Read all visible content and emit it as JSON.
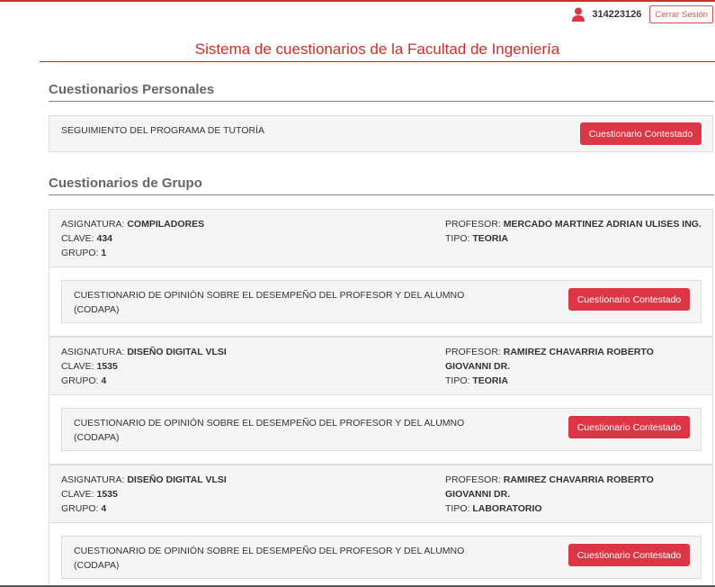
{
  "header": {
    "user_id": "314223126",
    "logout_label": "Cerrar Sesión",
    "system_title": "Sistema de cuestionarios de la Facultad de Ingeniería"
  },
  "personal": {
    "section_title": "Cuestionarios Personales",
    "item_title": "SEGUIMIENTO DEL PROGRAMA DE TUTORÍA",
    "button_label": "Cuestionario Contestado"
  },
  "groups_section": {
    "section_title": "Cuestionarios de Grupo",
    "labels": {
      "asignatura": "ASIGNATURA:",
      "clave": "CLAVE:",
      "grupo": "GRUPO:",
      "profesor": "PROFESOR:",
      "tipo": "TIPO:"
    },
    "groups": [
      {
        "asignatura": "COMPILADORES",
        "clave": "434",
        "grupo": "1",
        "profesor": "MERCADO MARTINEZ ADRIAN ULISES ING.",
        "tipo": "TEORIA",
        "quest_title": "CUESTIONARIO DE OPINIÓN SOBRE EL DESEMPEÑO DEL PROFESOR Y DEL ALUMNO (CODAPA)",
        "button_label": "Cuestionario Contestado"
      },
      {
        "asignatura": "DISEÑO DIGITAL VLSI",
        "clave": "1535",
        "grupo": "4",
        "profesor": "RAMIREZ CHAVARRIA ROBERTO GIOVANNI DR.",
        "tipo": "TEORIA",
        "quest_title": "CUESTIONARIO DE OPINIÓN SOBRE EL DESEMPEÑO DEL PROFESOR Y DEL ALUMNO (CODAPA)",
        "button_label": "Cuestionario Contestado"
      },
      {
        "asignatura": "DISEÑO DIGITAL VLSI",
        "clave": "1535",
        "grupo": "4",
        "profesor": "RAMIREZ CHAVARRIA ROBERTO GIOVANNI DR.",
        "tipo": "LABORATORIO",
        "quest_title": "CUESTIONARIO DE OPINIÓN SOBRE EL DESEMPEÑO DEL PROFESOR Y DEL ALUMNO (CODAPA)",
        "button_label": "Cuestionario Contestado"
      }
    ]
  },
  "colors": {
    "brand_red": "#c9302c",
    "button_red": "#dc3545"
  },
  "icons": {
    "user": "user-icon"
  }
}
